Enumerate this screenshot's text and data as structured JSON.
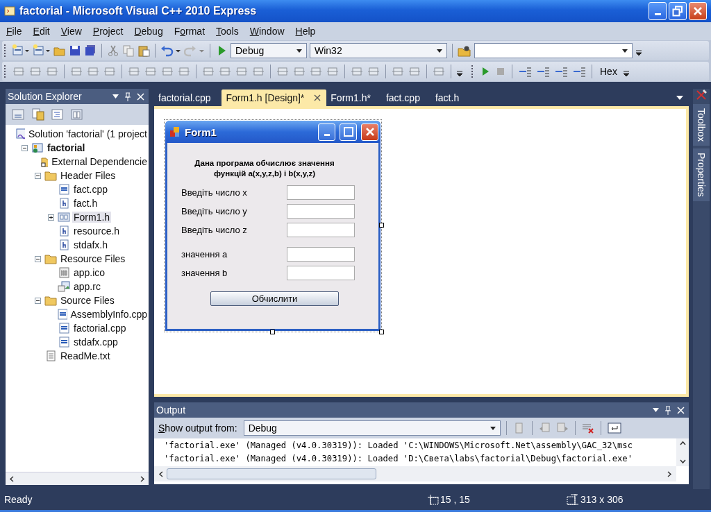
{
  "window": {
    "title": "factorial - Microsoft Visual C++ 2010 Express"
  },
  "menu": [
    {
      "key": "F",
      "after": "ile"
    },
    {
      "key": "E",
      "after": "dit"
    },
    {
      "key": "V",
      "after": "iew"
    },
    {
      "key": "P",
      "after": "roject"
    },
    {
      "key": "D",
      "after": "ebug"
    },
    {
      "before": "F",
      "key": "o",
      "after": "rmat"
    },
    {
      "key": "T",
      "after": "ools"
    },
    {
      "key": "W",
      "after": "indow"
    },
    {
      "key": "H",
      "after": "elp"
    }
  ],
  "toolbar": {
    "configuration": "Debug",
    "platform": "Win32",
    "hex_button": "Hex"
  },
  "solution_explorer": {
    "title": "Solution Explorer",
    "tree": [
      {
        "label": "Solution 'factorial' (1 project",
        "kind": "solution",
        "selected": false,
        "children": [
          {
            "label": "factorial",
            "kind": "project",
            "selected": false,
            "expanded": true,
            "children": [
              {
                "label": "External Dependencie",
                "kind": "external",
                "selected": false
              },
              {
                "label": "Header Files",
                "kind": "folder",
                "selected": false,
                "expanded": true,
                "children": [
                  {
                    "label": "fact.cpp",
                    "kind": "cpp",
                    "selected": false
                  },
                  {
                    "label": "fact.h",
                    "kind": "h",
                    "selected": false
                  },
                  {
                    "label": "Form1.h",
                    "kind": "form",
                    "selected": true,
                    "expanded": false
                  },
                  {
                    "label": "resource.h",
                    "kind": "h",
                    "selected": false
                  },
                  {
                    "label": "stdafx.h",
                    "kind": "h",
                    "selected": false
                  }
                ]
              },
              {
                "label": "Resource Files",
                "kind": "folder",
                "selected": false,
                "expanded": true,
                "children": [
                  {
                    "label": "app.ico",
                    "kind": "ico",
                    "selected": false
                  },
                  {
                    "label": "app.rc",
                    "kind": "rc",
                    "selected": false
                  }
                ]
              },
              {
                "label": "Source Files",
                "kind": "folder",
                "selected": false,
                "expanded": true,
                "children": [
                  {
                    "label": "AssemblyInfo.cpp",
                    "kind": "cpp",
                    "selected": false
                  },
                  {
                    "label": "factorial.cpp",
                    "kind": "cpp",
                    "selected": false
                  },
                  {
                    "label": "stdafx.cpp",
                    "kind": "cpp",
                    "selected": false
                  }
                ]
              },
              {
                "label": "ReadMe.txt",
                "kind": "txt",
                "selected": false
              }
            ]
          }
        ]
      }
    ]
  },
  "tabs": [
    {
      "label": "factorial.cpp",
      "selected": false
    },
    {
      "label": "Form1.h [Design]*",
      "selected": true
    },
    {
      "label": "Form1.h*",
      "selected": false
    },
    {
      "label": "fact.cpp",
      "selected": false
    },
    {
      "label": "fact.h",
      "selected": false
    }
  ],
  "form": {
    "title": "Form1",
    "description": "Дана програма обчислює значення\nфункцій a(x,y,z,b) і b(x,y,z)",
    "inputs": [
      {
        "label": "Введіть число x"
      },
      {
        "label": "Введіть число y"
      },
      {
        "label": "Введіть число z"
      }
    ],
    "outputs": [
      {
        "label": "значення a"
      },
      {
        "label": "значення b"
      }
    ],
    "button": "Обчислити"
  },
  "side_tabs": [
    "Toolbox",
    "Properties"
  ],
  "output": {
    "title": "Output",
    "source_label_key": "S",
    "source_label_rest": "how output from:",
    "source": "Debug",
    "lines": [
      "'factorial.exe' (Managed (v4.0.30319)): Loaded 'C:\\WINDOWS\\Microsoft.Net\\assembly\\GAC_32\\msc",
      "'factorial.exe' (Managed (v4.0.30319)): Loaded 'D:\\Света\\labs\\factorial\\Debug\\factorial.exe'"
    ]
  },
  "status_bar": {
    "text": "Ready",
    "position": "15 , 15",
    "size": "313 x 306"
  }
}
